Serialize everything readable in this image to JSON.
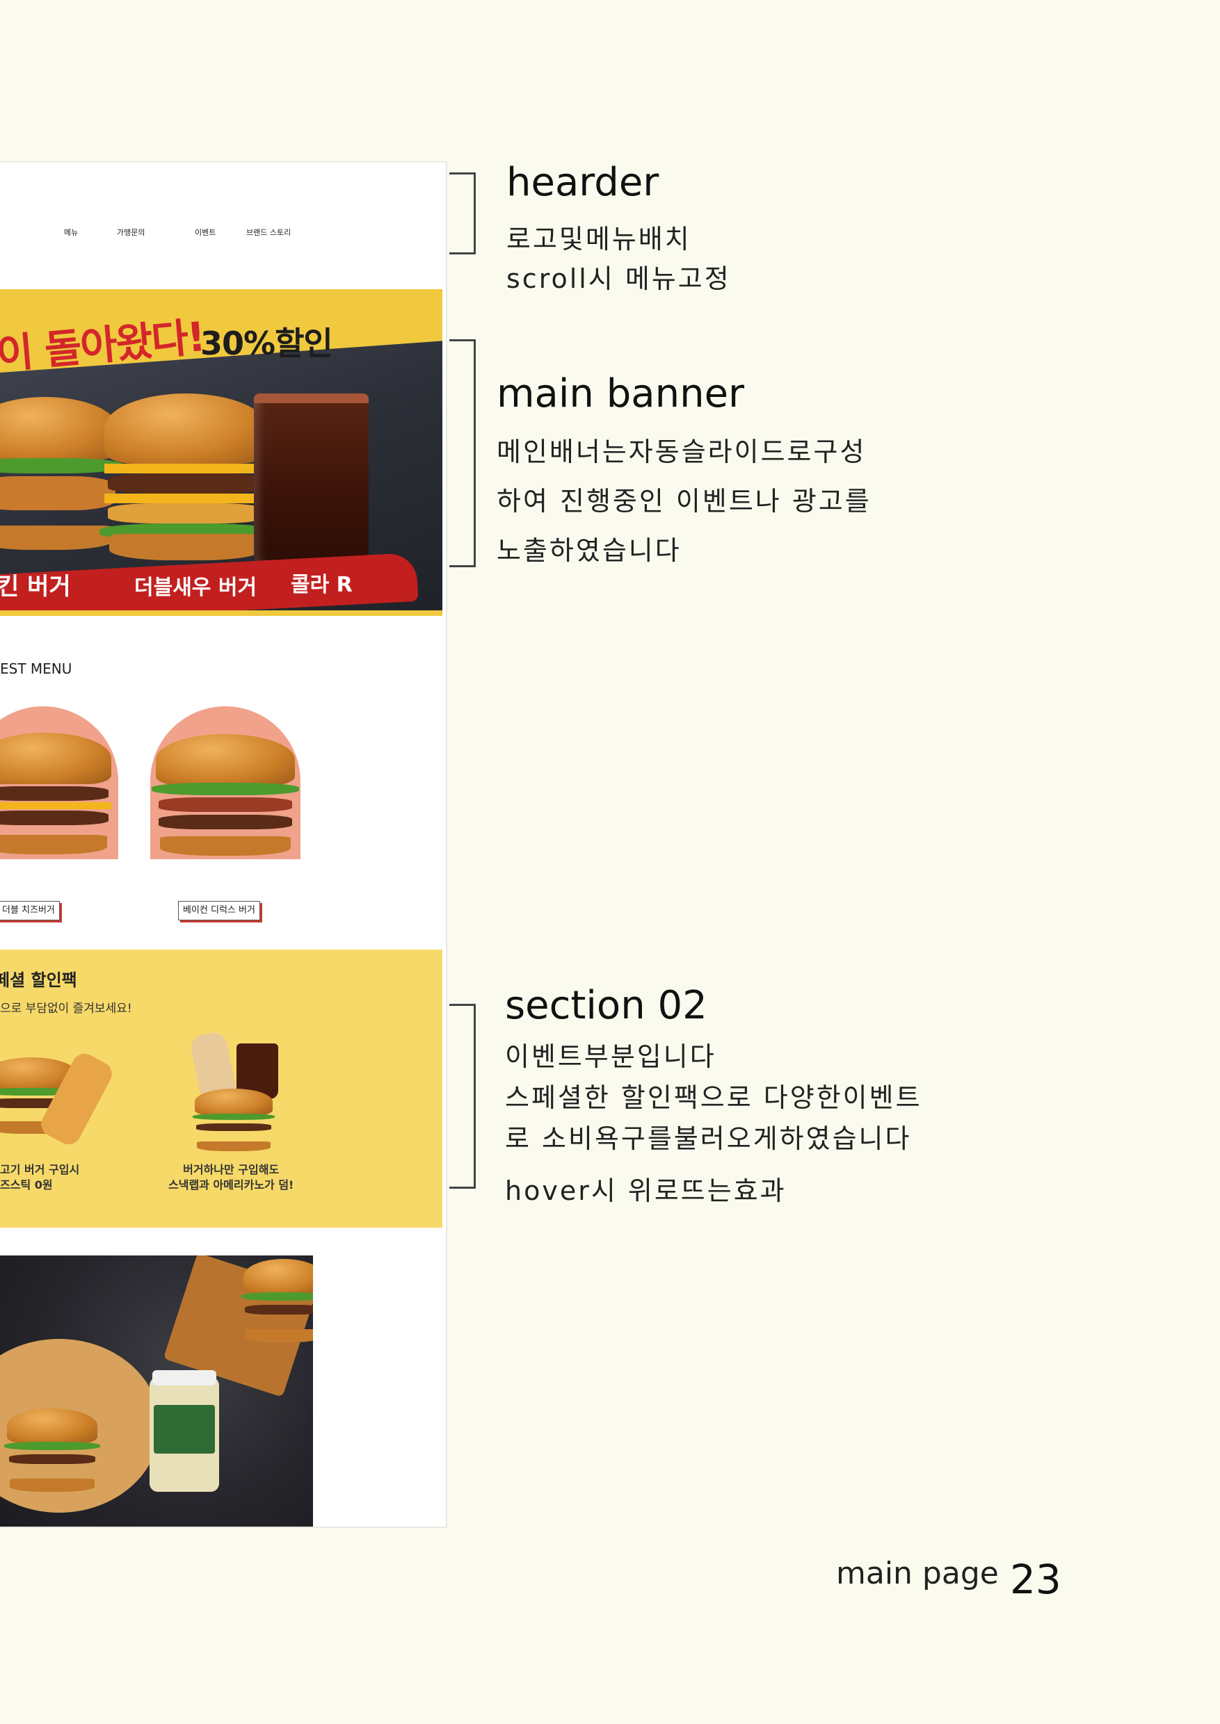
{
  "website": {
    "nav": [
      "메뉴",
      "가맹문의",
      "이벤트",
      "브랜드 스토리"
    ],
    "banner": {
      "headline": "이 돌아왔다!",
      "discount": "30%할인",
      "captions": [
        "킨 버거",
        "더블새우 버거",
        "콜라 R"
      ]
    },
    "best_menu": {
      "title": "EST MENU",
      "items": [
        "더블 치즈버거",
        "베이컨 디럭스 버거"
      ]
    },
    "special": {
      "title": "페셜 할인팩",
      "subtitle": "으로 부담없이 즐겨보세요!",
      "promos": [
        [
          "고기 버거 구입시",
          "즈스틱 0원"
        ],
        [
          "버거하나만 구입해도",
          "스낵랩과 아메리카노가 덤!"
        ]
      ]
    }
  },
  "annotations": {
    "header": {
      "title": "hearder",
      "lines": [
        "로고및메뉴배치",
        "scroll시 메뉴고정"
      ]
    },
    "banner": {
      "title": "main banner",
      "lines": [
        "메인배너는자동슬라이드로구성",
        "하여 진행중인 이벤트나 광고를",
        "노출하였습니다"
      ]
    },
    "section": {
      "title": "section 02",
      "lines": [
        "이벤트부분입니다",
        "스페셜한 할인팩으로  다양한이벤트",
        "로 소비욕구를불러오게하였습니다",
        "hover시 위로뜨는효과"
      ]
    }
  },
  "footer": {
    "label": "main page",
    "page": "23"
  },
  "colors": {
    "background": "#fafaee",
    "banner_yellow": "#f0c93f",
    "banner_red": "#c2201f",
    "special_bg": "#f6d969",
    "arch": "#f1a28b"
  }
}
